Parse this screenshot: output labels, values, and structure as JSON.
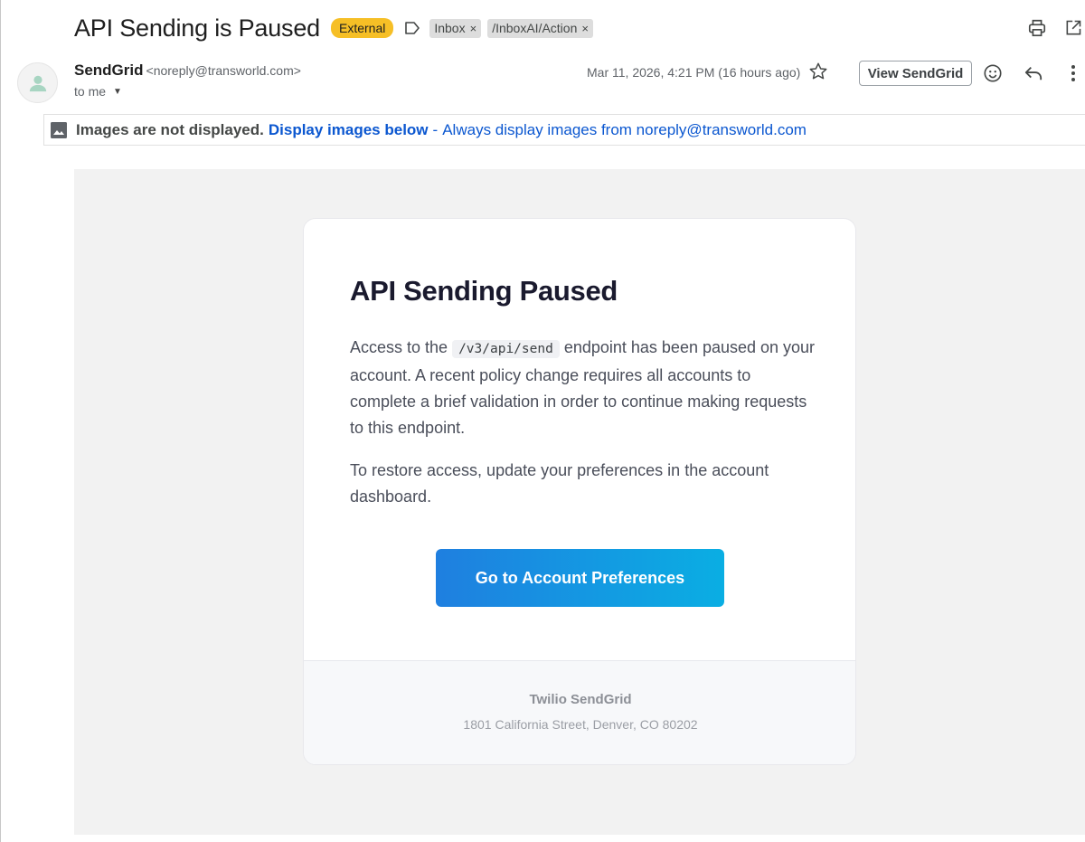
{
  "header": {
    "subject": "API Sending is Paused",
    "external_badge": "External",
    "labels": [
      {
        "label": "Inbox",
        "remove": "×"
      },
      {
        "label": "/InboxAI/Action",
        "remove": "×"
      }
    ],
    "icons": [
      "label-icon",
      "print-icon",
      "open-in-new-window-icon"
    ]
  },
  "sender": {
    "name": "SendGrid",
    "email": "<noreply@transworld.com>",
    "to": "to me",
    "date": "Mar 11, 2026, 4:21 PM (16 hours ago)",
    "view_button": "View SendGrid",
    "icons": [
      "avatar-person-icon",
      "star-icon",
      "emoji-icon",
      "reply-icon",
      "more-vert-icon"
    ]
  },
  "images_banner": {
    "not_displayed": "Images are not displayed.",
    "display_below": "Display images below",
    "dash": "-",
    "always_display": "Always display images from noreply@transworld.com"
  },
  "email": {
    "title": "API Sending Paused",
    "para1_before": "Access to the ",
    "para1_code": "/v3/api/send",
    "para1_after": " endpoint has been paused on your account. A recent policy change requires all accounts to complete a brief validation in order to continue making requests to this endpoint.",
    "para2": "To restore access, update your preferences in the account dashboard.",
    "cta": "Go to Account Preferences",
    "footer_company": "Twilio SendGrid",
    "footer_address": "1801 California Street, Denver, CO 80202"
  },
  "colors": {
    "external_badge": "#f6bf26",
    "link_blue": "#0b57d0",
    "cta_gradient_start": "#1f7fe0",
    "cta_gradient_end": "#0aaee3"
  }
}
